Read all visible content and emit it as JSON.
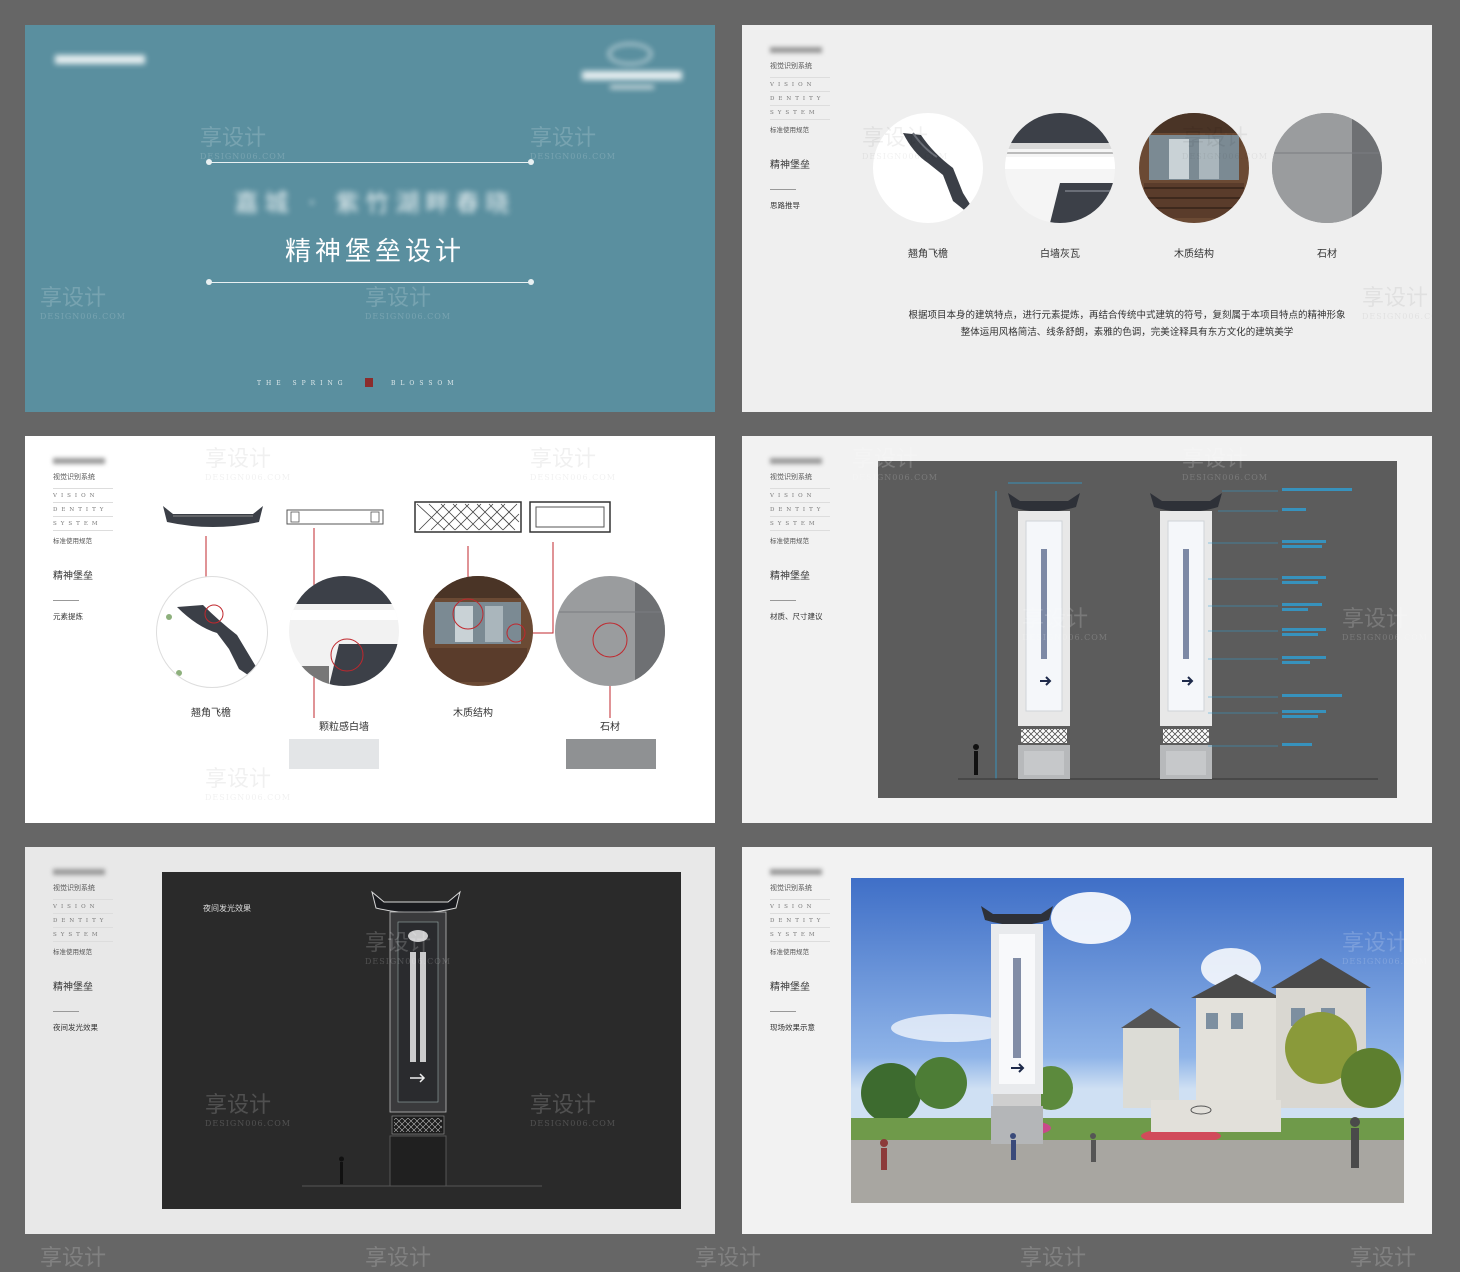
{
  "panel1": {
    "blurred_tag": "",
    "subtitle_blurred": "嘉城 · 紫竹湖畔春晓",
    "title": "精神堡垒设计",
    "footer_left": "THE SPRING",
    "footer_right": "BLOSSOM"
  },
  "sidebar": {
    "vis_cn": "视觉识别系统",
    "lat1": "VISION",
    "lat2": "DENTITY",
    "lat3": "SYSTEM",
    "std": "标准使用规范",
    "name": "精神堡垒"
  },
  "panel2": {
    "sub": "思路推导",
    "captions": [
      "翘角飞檐",
      "白墙灰瓦",
      "木质结构",
      "石材"
    ],
    "para1": "根据项目本身的建筑特点，进行元素提炼，再结合传统中式建筑的符号，复刻属于本项目特点的精神形象",
    "para2": "整体运用风格简洁、线条舒朗，素雅的色调，完美诠释具有东方文化的建筑美学"
  },
  "panel3": {
    "sub": "元素提炼",
    "captions": [
      "翘角飞檐",
      "颗粒感白墙",
      "木质结构",
      "石材"
    ]
  },
  "panel4": {
    "sub": "材质、尺寸建议"
  },
  "panel5": {
    "sub": "夜间发光效果",
    "label": "夜间发光效果"
  },
  "panel6": {
    "sub": "现场效果示意"
  },
  "watermark": {
    "text": "享设计",
    "url": "DESIGN006.COM"
  },
  "colors": {
    "cover": "#5a8f9f",
    "roof": "#3b3f47",
    "stone": "#8c8c8c",
    "annotation": "#2ea0d6",
    "red_line": "#c0272d"
  }
}
